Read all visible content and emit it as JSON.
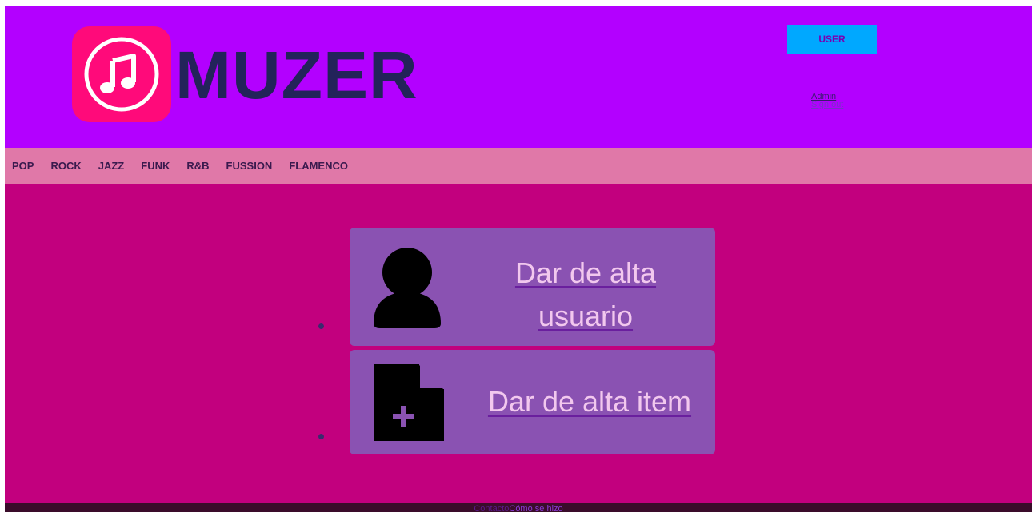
{
  "header": {
    "brand": "MUZER",
    "user_button": "USER",
    "user_menu": {
      "admin": "Admin",
      "sign_out": "Sign out"
    }
  },
  "nav": {
    "items": [
      "POP",
      "ROCK",
      "JAZZ",
      "FUNK",
      "R&B",
      "FUSSION",
      "FLAMENCO"
    ]
  },
  "main": {
    "cards": [
      {
        "label": "Dar de alta usuario",
        "icon": "user-icon"
      },
      {
        "label": "Dar de alta item",
        "icon": "new-file-icon"
      }
    ]
  },
  "footer": {
    "contact": "Contacto",
    "how_made": "Cómo se hizo"
  },
  "colors": {
    "header_bg": "#b300ff",
    "nav_bg": "#e078a8",
    "main_bg": "#c2007e",
    "card_bg": "#8a52b2",
    "logo_bg": "#ff0a7a",
    "user_button_bg": "#00a8ff"
  }
}
